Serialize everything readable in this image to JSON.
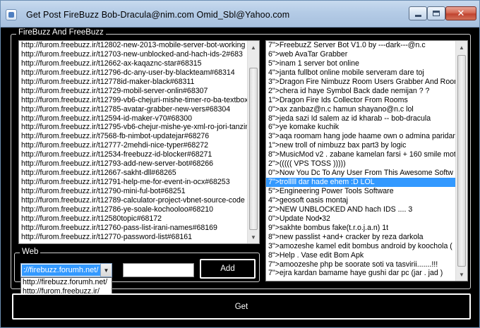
{
  "window": {
    "title": "Get Post FireBuzz    Bob-Dracula@nim.com    Omid_Sbl@Yahoo.com",
    "minimize_label": "–",
    "maximize_label": "",
    "close_label": "✕"
  },
  "group": {
    "label": "FireBuzz And FreeBuzz"
  },
  "left_list": {
    "items": [
      "http://furom.freebuzz.ir/t12802-new-2013-mobile-server-bot-working",
      "http://furom.freebuzz.ir/t12703-new-unblocked-and-hach-ids-2#683",
      "http://furom.freebuzz.ir/t12662-ax-kaqaznc-star#68315",
      "http://furom.freebuzz.ir/t12796-dc-any-user-by-blackteam#68314",
      "http://furom.freebuzz.ir/t12778id-maker-black#68311",
      "http://furom.freebuzz.ir/t12729-mobil-server-onlin#68307",
      "http://furom.freebuzz.ir/t12799-vb6-chejuri-mishe-timer-ro-ba-textbox",
      "http://furom.freebuzz.ir/t12785-avatar-grabber-new-vers#68304",
      "http://furom.freebuzz.ir/t12594-id-maker-v70#68300",
      "http://furom.freebuzz.ir/t12795-vb6-chejur-mishe-ye-xml-ro-jori-tanzim",
      "http://furom.freebuzz.ir/t7568-fb-nimbot-updatejar#68276",
      "http://furom.freebuzz.ir/t12777-2mehdi-nice-typer#68272",
      "http://furom.freebuzz.ir/t12534-freebuzz-id-blocker#68271",
      "http://furom.freebuzz.ir/t12793-add-new-server-bot#68266",
      "http://furom.freebuzz.ir/t12667-sakht-dll#68265",
      "http://furom.freebuzz.ir/t12791-help-me-for-event-in-ocx#68253",
      "http://furom.freebuzz.ir/t12790-mini-ful-bot#68251",
      "http://furom.freebuzz.ir/t12789-calculator-project-vbnet-source-code",
      "http://furom.freebuzz.ir/t12786-ye-soale-kochooloo#68210",
      "http://furom.freebuzz.ir/t12580topic#68172",
      "http://furom.freebuzz.ir/t12760-pass-list-irani-names#68169",
      "http://furom.freebuzz.ir/t12770-password-list#68161"
    ]
  },
  "right_list": {
    "selected_index": 15,
    "items": [
      "7\">FreebuzZ Server Bot V1.0 by ---dark---@n.c",
      "6\">web AvaTar Grabber",
      "5\">inam 1 server bot  online",
      "4\">janta fullbot online mobile serveram dare toj",
      "3\">Dragon Fire Nimbuzz Room Users Grabber And Room",
      "2\">chera id haye Symbol Back dade nemijan ? ?",
      "1\">Dragon Fire Ids Collector From Rooms",
      "0\">ax zanbaz@n.c hamun shayano@n.c lol",
      "8\">jeda sazi Id salem az id kharab -- bob-dracula",
      "6\">ye komake kuchik",
      "3\">aqa roomam hang jode haame own o admina paridan",
      "1\">new troll of nimbuzz bax part3 by logic",
      "8\">MusicMod v2 . zabane kamelan farsi + 160 smile mot",
      "2\">(((((  VPS TOSS  )))))",
      "0\">Now You Dc To Any User From This Awesome Softw",
      "7\">trolllll dar hade ehem :D LOL",
      "5\">Engineering Power Tools Software",
      "4\">geosoft oasis montaj",
      "2\">NEW UNBLOCKED AND hach IDS .... 3",
      "0\">Update Nod•32",
      "9\">sakhte bombus fake(t.r.o.j.a.n) 1t",
      "8\">new passlist +and+ cracker by reza darkola",
      "3\">amozeshe kamel edit bombus android by koochola (",
      "8\">Help . Vase edit  Bom Apk",
      "7\">amoozeshe php be soorate soti va tasvirii.......!!!",
      "7\">ejra kardan bamame haye gushi dar pc (jar . jad )"
    ]
  },
  "web": {
    "label": "Web",
    "combo_value": "://firebuzz.forumh.net/",
    "options": [
      "http://firebuzz.forumh.net/",
      "http://furom.freebuzz.ir/"
    ],
    "textbox_value": "",
    "add_label": "Add"
  },
  "get_label": "Get",
  "colors": {
    "selection": "#3399ff",
    "background": "#000000",
    "scribble": "#1a2fd6"
  }
}
